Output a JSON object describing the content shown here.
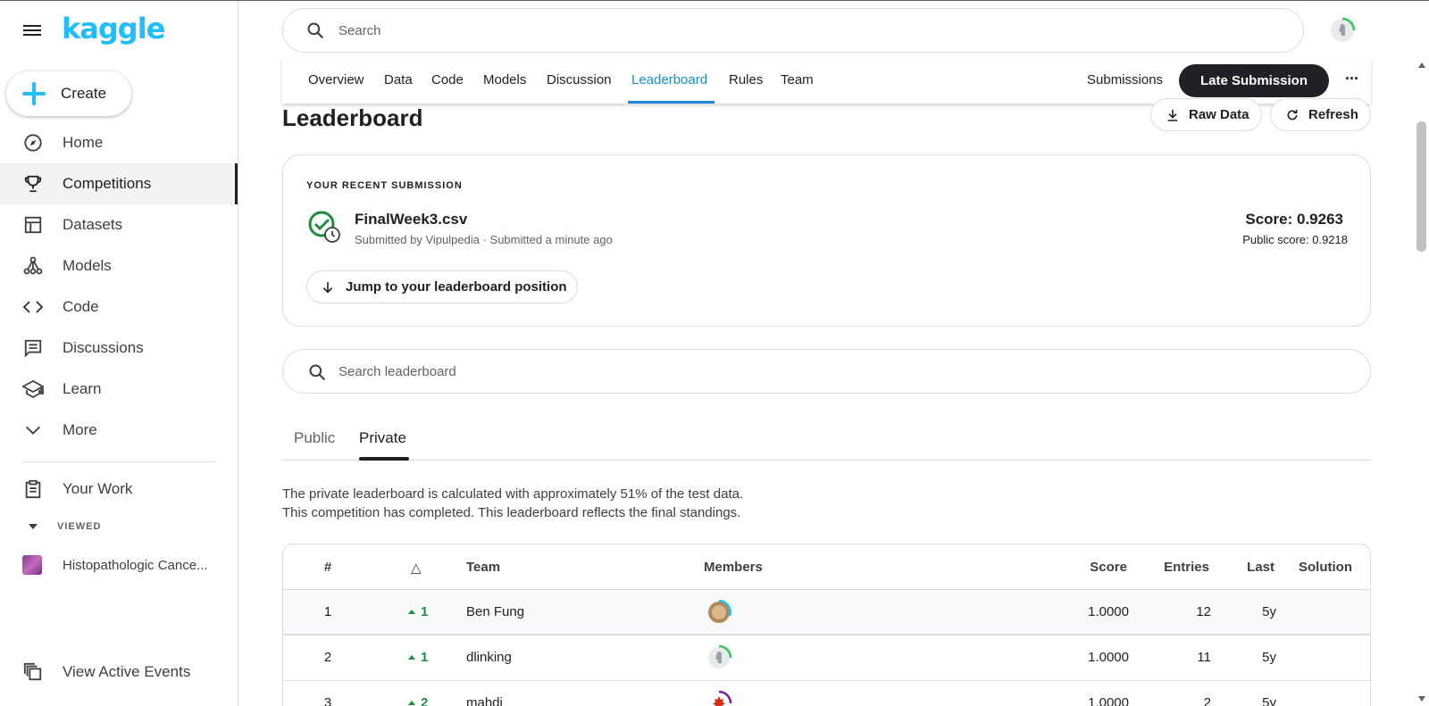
{
  "app": {
    "logo": "kaggle"
  },
  "sidebar": {
    "create_label": "Create",
    "items": [
      {
        "label": "Home",
        "icon": "compass-icon"
      },
      {
        "label": "Competitions",
        "icon": "trophy-icon"
      },
      {
        "label": "Datasets",
        "icon": "table-icon"
      },
      {
        "label": "Models",
        "icon": "models-icon"
      },
      {
        "label": "Code",
        "icon": "code-icon"
      },
      {
        "label": "Discussions",
        "icon": "comment-icon"
      },
      {
        "label": "Learn",
        "icon": "school-icon"
      },
      {
        "label": "More",
        "icon": "chevron-down-icon"
      }
    ],
    "your_work": "Your Work",
    "viewed_header": "VIEWED",
    "viewed_item": "Histopathologic Cance...",
    "view_active_events": "View Active Events"
  },
  "search": {
    "placeholder": "Search"
  },
  "tabs": [
    {
      "label": "Overview"
    },
    {
      "label": "Data"
    },
    {
      "label": "Code"
    },
    {
      "label": "Models"
    },
    {
      "label": "Discussion"
    },
    {
      "label": "Leaderboard",
      "active": true
    },
    {
      "label": "Rules"
    },
    {
      "label": "Team"
    }
  ],
  "tab_actions": {
    "submissions": "Submissions",
    "late_submission": "Late Submission",
    "more": "···"
  },
  "page": {
    "title": "Leaderboard",
    "raw_data": "Raw Data",
    "refresh": "Refresh"
  },
  "recent": {
    "kicker": "YOUR RECENT SUBMISSION",
    "file": "FinalWeek3.csv",
    "meta": "Submitted by Vipulpedia · Submitted a minute ago",
    "score": "Score: 0.9263",
    "public_score": "Public score: 0.9218",
    "jump": "Jump to your leaderboard position"
  },
  "lb_search": {
    "placeholder": "Search leaderboard"
  },
  "lb_tabs": {
    "public": "Public",
    "private": "Private"
  },
  "notes": {
    "line1": "The private leaderboard is calculated with approximately 51% of the test data.",
    "line2": "This competition has completed. This leaderboard reflects the final standings."
  },
  "table": {
    "headers": {
      "rank": "#",
      "delta": "△",
      "team": "Team",
      "members": "Members",
      "score": "Score",
      "entries": "Entries",
      "last": "Last",
      "solution": "Solution"
    },
    "rows": [
      {
        "rank": "1",
        "delta": "1",
        "team": "Ben Fung",
        "score": "1.0000",
        "entries": "12",
        "last": "5y"
      },
      {
        "rank": "2",
        "delta": "1",
        "team": "dlinking",
        "score": "1.0000",
        "entries": "11",
        "last": "5y"
      },
      {
        "rank": "3",
        "delta": "2",
        "team": "mahdi",
        "score": "1.0000",
        "entries": "2",
        "last": "5y"
      }
    ]
  },
  "colors": {
    "brand": "#20beff",
    "active_tab": "#1a8bd6",
    "positive": "#1e8e3e"
  }
}
